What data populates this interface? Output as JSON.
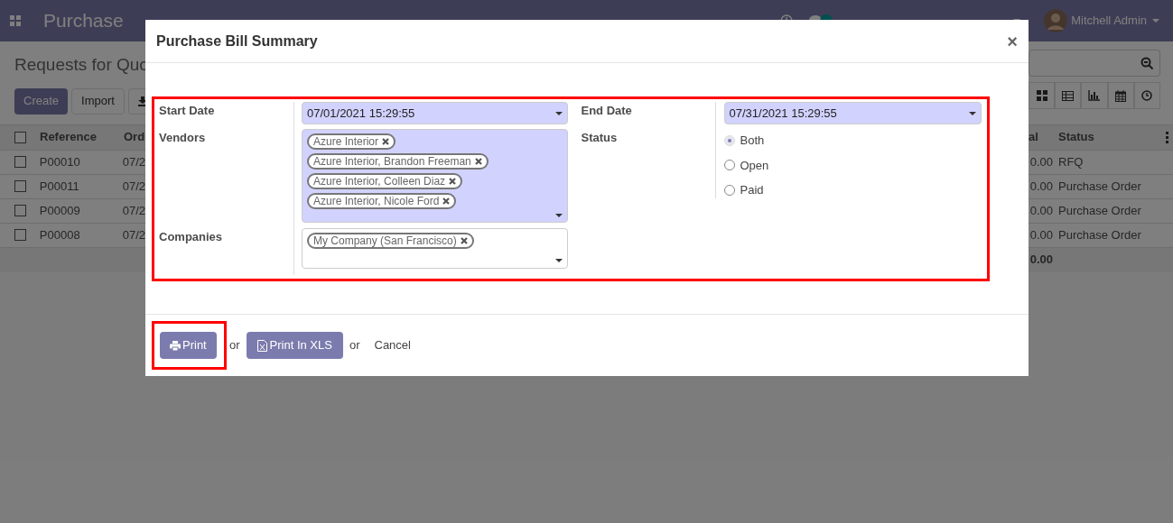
{
  "navbar": {
    "app_name": "Purchase",
    "user": "Mitchell Admin"
  },
  "page": {
    "title": "Requests for Quo",
    "buttons": [
      "Create",
      "Import"
    ],
    "select_all_checked": false,
    "columns_left": [
      "Reference",
      "Ord"
    ],
    "columns_right": [
      "al",
      "Status"
    ],
    "rows": [
      {
        "checked": false,
        "reference": "P00010",
        "column_2": "07/2",
        "total": "0.00",
        "status": "RFQ"
      },
      {
        "checked": false,
        "reference": "P00011",
        "column_2": "07/2",
        "total": "0.00",
        "status": "Purchase Order"
      },
      {
        "checked": false,
        "reference": "P00009",
        "column_2": "07/2",
        "total": "0.00",
        "status": "Purchase Order"
      },
      {
        "checked": false,
        "reference": "P00008",
        "column_2": "07/2",
        "total": "0.00",
        "status": "Purchase Order"
      }
    ],
    "grand_total": "0.00"
  },
  "dialog": {
    "title": "Purchase Bill Summary",
    "close": "×",
    "start_date": {
      "label": "Start Date",
      "value": "07/01/2021 15:29:55"
    },
    "end_date": {
      "label": "End Date",
      "value": "07/31/2021 15:29:55"
    },
    "vendors": {
      "label": "Vendors",
      "tags": [
        "Azure Interior",
        "Azure Interior, Brandon Freeman",
        "Azure Interior, Colleen Diaz",
        "Azure Interior, Nicole Ford"
      ]
    },
    "status": {
      "label": "Status",
      "options": [
        {
          "label": "Both",
          "selected": true
        },
        {
          "label": "Open",
          "selected": false
        },
        {
          "label": "Paid",
          "selected": false
        }
      ]
    },
    "companies": {
      "label": "Companies",
      "tags": [
        "My Company (San Francisco)"
      ]
    },
    "footer": {
      "print": "Print",
      "or_1": "or",
      "print_xls": "Print In XLS",
      "or_2": "or",
      "cancel": "Cancel"
    }
  }
}
